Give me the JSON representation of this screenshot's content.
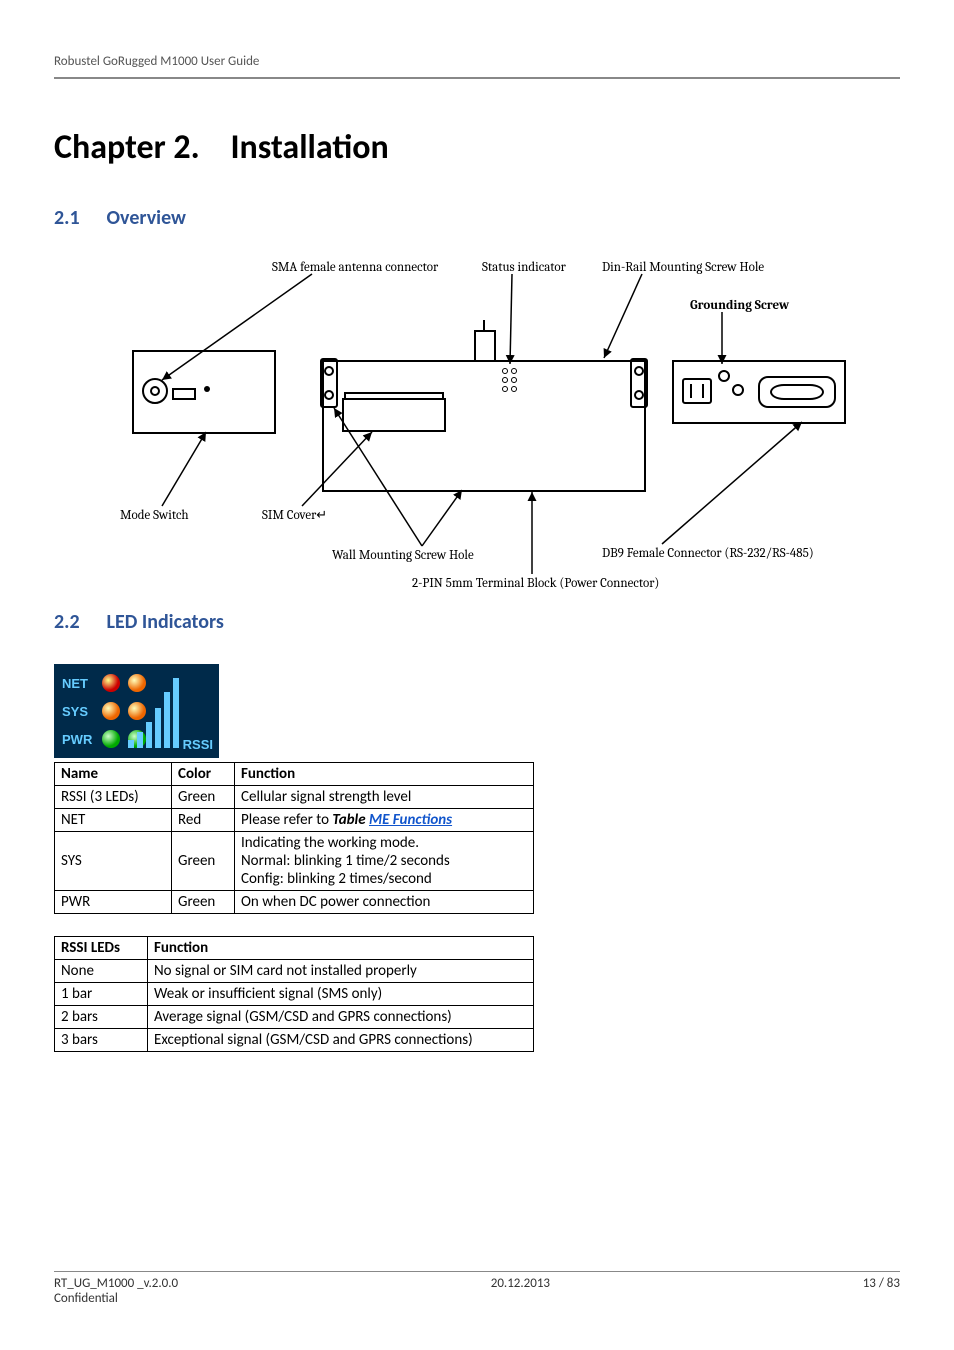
{
  "header": {
    "running": "Robustel GoRugged M1000 User Guide"
  },
  "chapter": {
    "label": "Chapter 2.",
    "title": "Installation"
  },
  "section_overview": {
    "number": "2.1",
    "title": "Overview"
  },
  "overview_labels": {
    "sma": "SMA female antenna connector",
    "status": "Status indicator",
    "dinrail": "Din-Rail Mounting Screw Hole",
    "grounding": "Grounding Screw",
    "mode": "Mode Switch",
    "simcover": "SIM Cover↵",
    "wallmount": "Wall Mounting Screw Hole",
    "db9": "DB9 Female Connector (RS-232/RS-485)",
    "terminal": "2-PIN 5mm Terminal Block (Power Connector)"
  },
  "section_leds": {
    "number": "2.2",
    "title": "LED Indicators"
  },
  "led_panel": {
    "net": "NET",
    "sys": "SYS",
    "pwr": "PWR",
    "rssi": "RSSI"
  },
  "led_table": {
    "headers": {
      "name": "Name",
      "color": "Color",
      "function": "Function"
    },
    "rows": [
      {
        "name": "RSSI (3 LEDs)",
        "color": "Green",
        "function": "Cellular signal strength level"
      },
      {
        "name": "NET",
        "color": "Red",
        "function_prefix": "Please refer to ",
        "function_table_word": "Table ",
        "function_link": "ME Functions"
      },
      {
        "name": "SYS",
        "color": "Green",
        "function_l1": "Indicating the working mode.",
        "function_l2": "Normal: blinking 1 time/2 seconds",
        "function_l3": "Config: blinking 2 times/second"
      },
      {
        "name": "PWR",
        "color": "Green",
        "function": "On when DC power connection"
      }
    ]
  },
  "rssi_table": {
    "headers": {
      "leds": "RSSI LEDs",
      "function": "Function"
    },
    "rows": [
      {
        "leds": "None",
        "function": "No signal or SIM card not installed properly"
      },
      {
        "leds": "1 bar",
        "function": "Weak or insufficient signal (SMS only)"
      },
      {
        "leds": "2 bars",
        "function": "Average signal (GSM/CSD and GPRS connections)"
      },
      {
        "leds": "3 bars",
        "function": "Exceptional signal (GSM/CSD and GPRS connections)"
      }
    ]
  },
  "footer": {
    "doc": "RT_UG_M1000 _v.2.0.0",
    "date": "20.12.2013",
    "page": "13 / 83",
    "confidential": "Confidential"
  }
}
